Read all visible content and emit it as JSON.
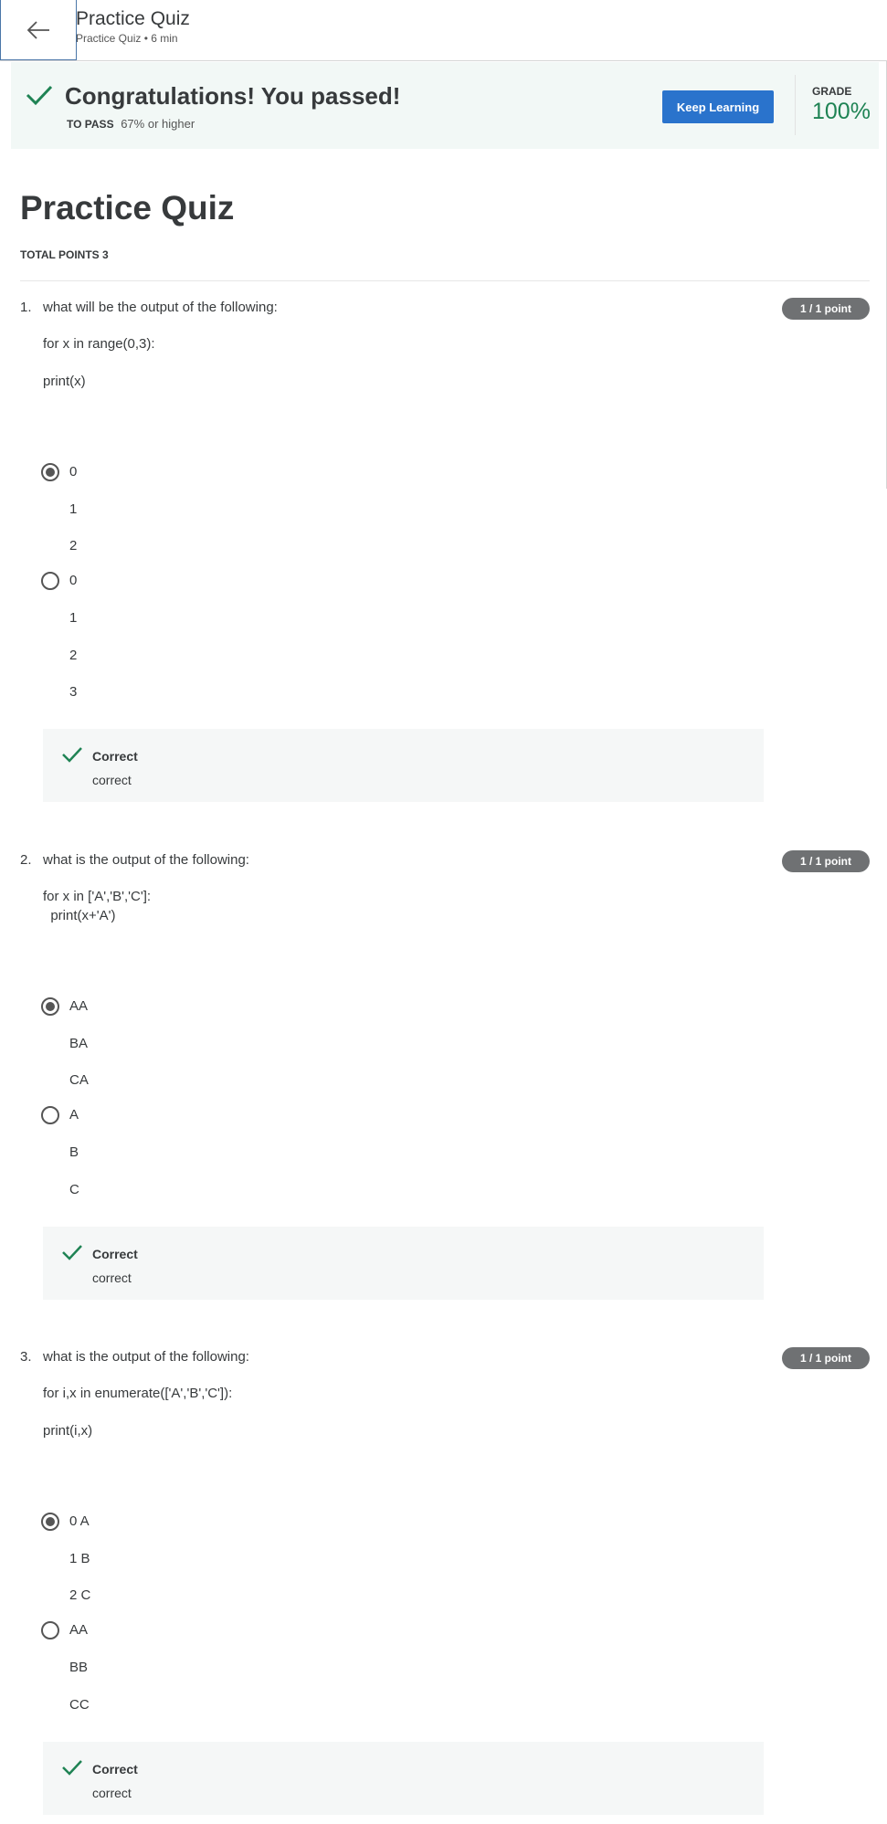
{
  "header": {
    "title": "Practice Quiz",
    "subtitle": "Practice Quiz • 6 min"
  },
  "banner": {
    "title": "Congratulations! You passed!",
    "to_pass_label": "TO PASS",
    "to_pass_value": "67% or higher",
    "keep_learning": "Keep Learning",
    "grade_label": "GRADE",
    "grade_value": "100%"
  },
  "page": {
    "title": "Practice Quiz",
    "total_points": "TOTAL POINTS 3"
  },
  "questions": [
    {
      "number": "1.",
      "text": "what will be the output of the following:",
      "code": [
        "for x in range(0,3):",
        "print(x)"
      ],
      "points": "1 / 1 point",
      "options": [
        {
          "lines": [
            "0",
            "1",
            "2"
          ],
          "selected": true
        },
        {
          "lines": [
            "0",
            "1",
            "2",
            "3"
          ],
          "selected": false
        }
      ],
      "feedback": {
        "title": "Correct",
        "text": "correct"
      }
    },
    {
      "number": "2.",
      "text": "what is the output of the following:",
      "code": [
        "for x in ['A','B','C']:",
        "  print(x+'A')"
      ],
      "points": "1 / 1 point",
      "options": [
        {
          "lines": [
            "AA",
            "BA",
            "CA"
          ],
          "selected": true
        },
        {
          "lines": [
            "A",
            "B",
            "C"
          ],
          "selected": false
        }
      ],
      "feedback": {
        "title": "Correct",
        "text": "correct"
      }
    },
    {
      "number": "3.",
      "text": "what is the output of the following:",
      "code": [
        "for i,x in enumerate(['A','B','C']):",
        "print(i,x)"
      ],
      "points": "1 / 1 point",
      "options": [
        {
          "lines": [
            "0 A",
            "1 B",
            "2 C"
          ],
          "selected": true
        },
        {
          "lines": [
            "AA",
            "BB",
            "CC"
          ],
          "selected": false
        }
      ],
      "feedback": {
        "title": "Correct",
        "text": "correct"
      }
    }
  ],
  "colors": {
    "accent": "#2a73cc",
    "success": "#1f8354",
    "badge": "#6f7173"
  },
  "icons": {
    "back": "arrow-left-icon",
    "check": "checkmark-icon"
  }
}
